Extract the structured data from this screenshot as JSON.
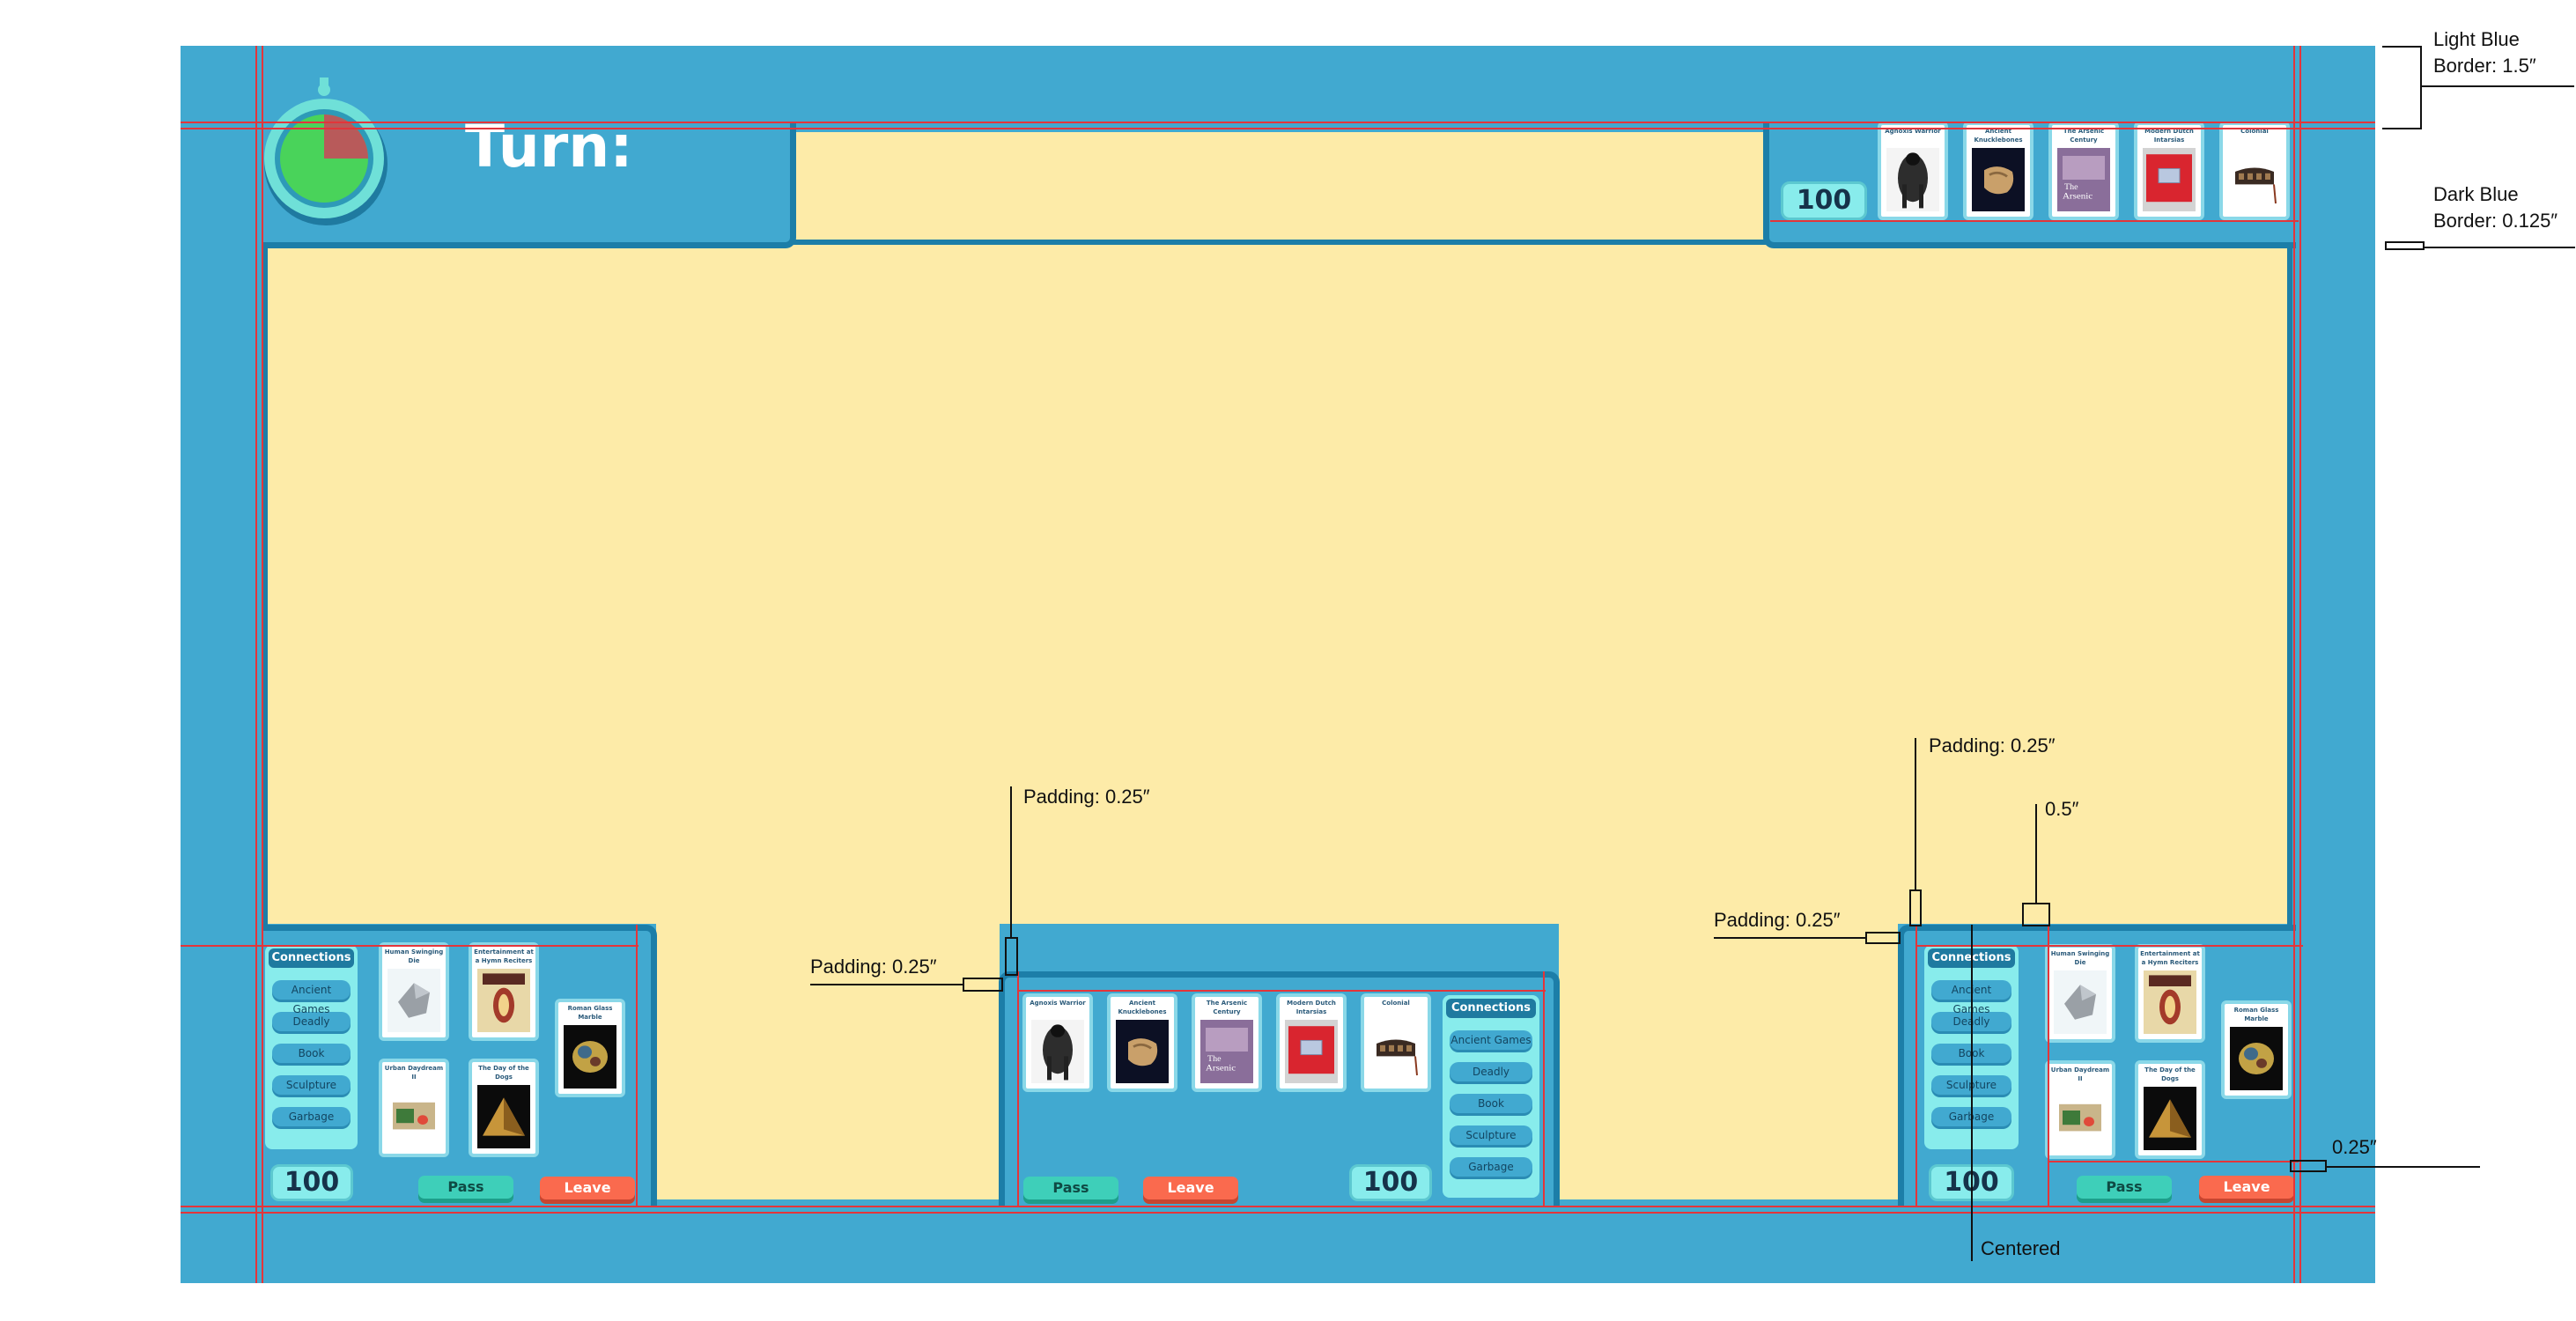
{
  "header": {
    "turn_label": "Turn:"
  },
  "colors": {
    "board_blue": "#41a9d0",
    "border_dark_blue": "#1c7ea8",
    "play_area": "#fdeba8",
    "score_bg": "#88ecec",
    "pass_button": "#3ecfb9",
    "leave_button": "#fa6a4e",
    "guide_red": "#e3353a",
    "timer_green": "#49d35a",
    "timer_red": "#b85a5a"
  },
  "timer": {
    "elapsed_fraction": 0.25
  },
  "top_player": {
    "score": "100",
    "cards": [
      "Agnoxis Warrior",
      "Ancient Knucklebones",
      "The Arsenic Century",
      "Modern Dutch Intarsias",
      "Colonial"
    ]
  },
  "center_player": {
    "cards": [
      "Agnoxis Warrior",
      "Ancient Knucklebones",
      "The Arsenic Century",
      "Modern Dutch Intarsias",
      "Colonial"
    ],
    "connections_title": "Connections",
    "connections": [
      "Ancient Games",
      "Deadly",
      "Book",
      "Sculpture",
      "Garbage"
    ],
    "score": "100",
    "pass_label": "Pass",
    "leave_label": "Leave"
  },
  "left_player": {
    "connections_title": "Connections",
    "connections": [
      "Ancient Games",
      "Deadly",
      "Book",
      "Sculpture",
      "Garbage"
    ],
    "cards": [
      "Human Swinging Die",
      "Entertainment at a Hymn Reciters",
      "Urban Daydream II",
      "The Day of the Dogs",
      "Roman Glass Marble"
    ],
    "score": "100",
    "pass_label": "Pass",
    "leave_label": "Leave"
  },
  "right_player": {
    "connections_title": "Connections",
    "connections": [
      "Ancient Games",
      "Deadly",
      "Book",
      "Sculpture",
      "Garbage"
    ],
    "cards": [
      "Human Swinging Die",
      "Entertainment at a Hymn Reciters",
      "Urban Daydream II",
      "The Day of the Dogs",
      "Roman Glass Marble"
    ],
    "score": "100",
    "pass_label": "Pass",
    "leave_label": "Leave"
  },
  "annotations": {
    "light_blue_border": "Light Blue\nBorder: 1.5″",
    "dark_blue_border": "Dark Blue\nBorder: 0.125″",
    "padding_center_top": "Padding: 0.25″",
    "padding_center_left": "Padding: 0.25″",
    "padding_right_top": "Padding: 0.25″",
    "half_inch": "0.5″",
    "padding_right_left": "Padding: 0.25″",
    "quarter_inch": "0.25″",
    "centered": "Centered"
  }
}
